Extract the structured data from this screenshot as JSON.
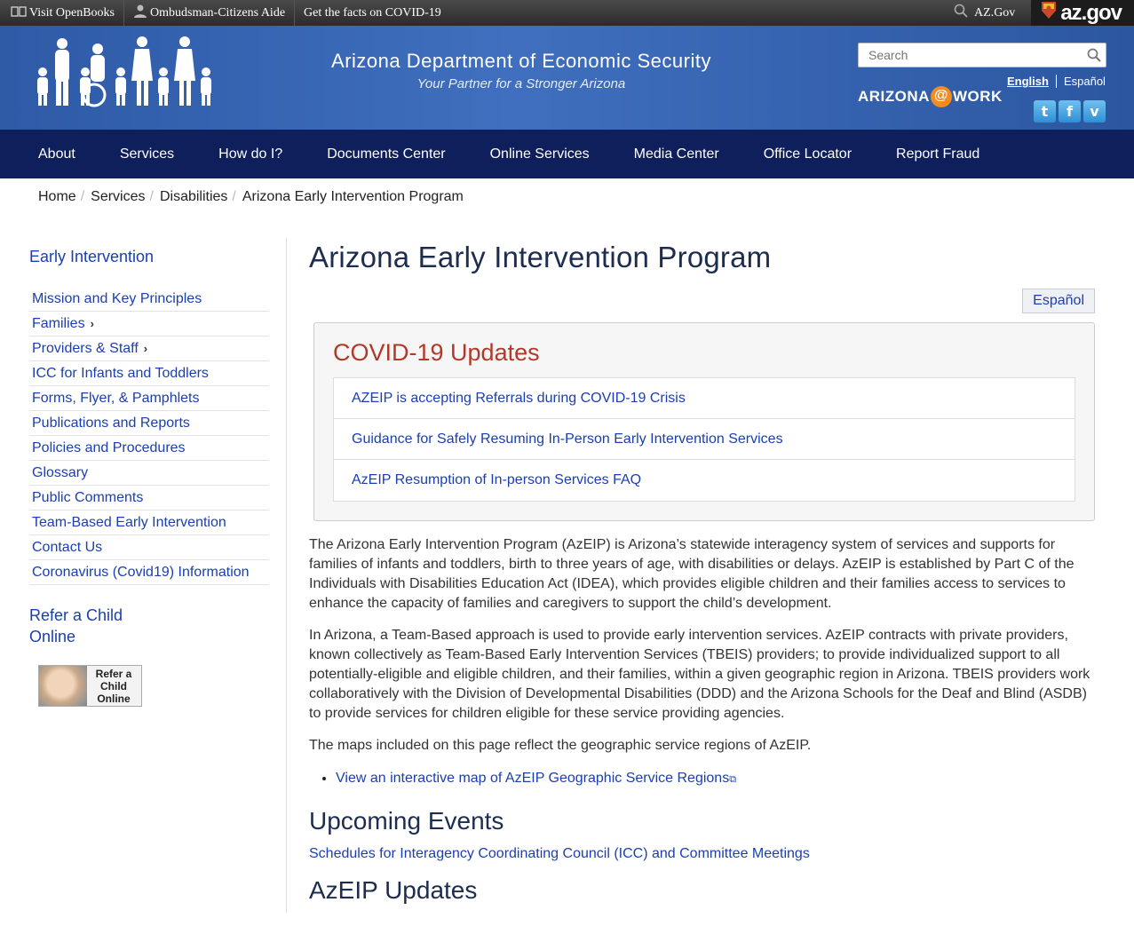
{
  "topbar": {
    "openbooks": "Visit OpenBooks",
    "ombudsman": "Ombudsman-Citizens Aide",
    "covid_facts": "Get the facts on COVID-19",
    "azgov_link": "AZ.Gov",
    "azgov_logo": "az.gov"
  },
  "header": {
    "title": "Arizona Department of Economic Security",
    "tagline": "Your Partner for a Stronger Arizona",
    "search_placeholder": "Search",
    "azwork_left": "ARIZONA",
    "azwork_at": "@",
    "azwork_right": "WORK",
    "lang_english": "English",
    "lang_espanol": "Español",
    "social": {
      "twitter": "t",
      "facebook": "f",
      "vimeo": "v"
    }
  },
  "nav": {
    "items": [
      "About",
      "Services",
      "How do I?",
      "Documents Center",
      "Online Services",
      "Media Center",
      "Office Locator",
      "Report Fraud"
    ]
  },
  "breadcrumb": [
    "Home",
    "Services",
    "Disabilities",
    "Arizona Early Intervention Program"
  ],
  "sidebar": {
    "title": "Early Intervention",
    "items": [
      "Mission and Key Principles",
      "Families",
      "Providers & Staff",
      "ICC for Infants and Toddlers",
      "Forms, Flyer, & Pamphlets",
      "Publications and Reports",
      "Policies and Procedures",
      "Glossary",
      "Public Comments",
      "Team-Based Early Intervention",
      "Contact Us",
      "Coronavirus (Covid19) Information"
    ],
    "refer_title": "Refer a Child Online",
    "refer_image_text": "Refer a Child Online"
  },
  "main": {
    "title": "Arizona Early Intervention Program",
    "espanol_button": "Español",
    "covid": {
      "title": "COVID-19 Updates",
      "links": [
        "AZEIP is accepting Referrals during COVID-19 Crisis",
        "Guidance for Safely Resuming In-Person Early Intervention Services",
        "AzEIP Resumption of In-person Services FAQ"
      ]
    },
    "p1": "The Arizona Early Intervention Program (AzEIP) is Arizona’s statewide interagency system of services and supports for families of infants and toddlers, birth to three years of age, with disabilities or delays. AzEIP is established by Part C of the Individuals with Disabilities Education Act (IDEA), which provides eligible children and their families access to services to enhance the capacity of families and caregivers to support the child’s development.",
    "p2": "In Arizona, a Team-Based approach is used to provide early intervention services. AzEIP contracts with private providers, known collectively as Team-Based Early Intervention Services (TBEIS) providers; to provide individualized support to all potentially-eligible and eligible children, and their families, within a given geographic region in Arizona. TBEIS providers work collaboratively with the Division of Developmental Disabilities (DDD) and the Arizona Schools for the Deaf and Blind (ASDB) to provide services for children eligible for these service providing agencies.",
    "p3": "The maps included on this page reflect the geographic service regions of AzEIP.",
    "map_link": "View an interactive map of AzEIP Geographic Service Regions",
    "upcoming_title": "Upcoming Events",
    "schedule_link": "Schedules for Interagency Coordinating Council (ICC) and Committee Meetings",
    "updates_title": "AzEIP Updates"
  }
}
